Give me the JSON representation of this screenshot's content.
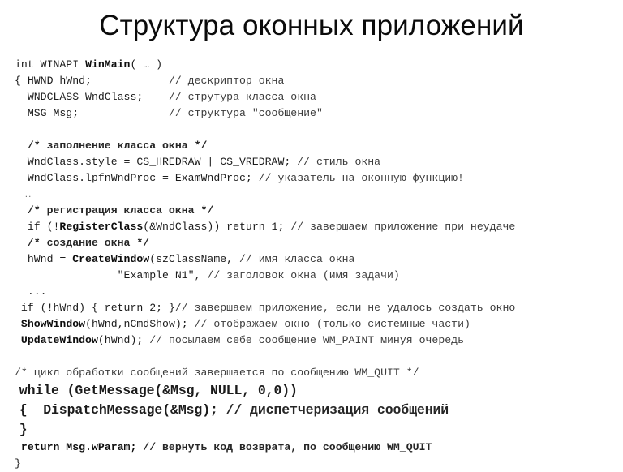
{
  "slide": {
    "title": "Структура оконных приложений",
    "background_color": "#ffffff",
    "text_color": "#1b1b1b",
    "comment_color": "#3c3c3c"
  },
  "code": {
    "language": "c",
    "lines": [
      {
        "id": "l01",
        "indent": 0,
        "size": "normal",
        "segments": [
          {
            "text": "int WINAPI ",
            "style": "plain"
          },
          {
            "text": "WinMain",
            "style": "kw"
          },
          {
            "text": "( … )",
            "style": "plain"
          }
        ]
      },
      {
        "id": "l02",
        "indent": 0,
        "size": "normal",
        "segments": [
          {
            "text": "{ HWND hWnd;            ",
            "style": "plain"
          },
          {
            "text": "// дескриптор окна",
            "style": "cmt"
          }
        ]
      },
      {
        "id": "l03",
        "indent": 0,
        "size": "normal",
        "segments": [
          {
            "text": "  WNDCLASS WndClass;    ",
            "style": "plain"
          },
          {
            "text": "// струтура класса окна",
            "style": "cmt"
          }
        ]
      },
      {
        "id": "l04",
        "indent": 0,
        "size": "normal",
        "segments": [
          {
            "text": "  MSG Msg;              ",
            "style": "plain"
          },
          {
            "text": "// структура \"сообщение\"",
            "style": "cmt"
          }
        ]
      },
      {
        "id": "l05",
        "indent": 0,
        "size": "normal",
        "segments": [
          {
            "text": " ",
            "style": "plain"
          }
        ]
      },
      {
        "id": "l06",
        "indent": 0,
        "size": "normal",
        "segments": [
          {
            "text": "  ",
            "style": "plain"
          },
          {
            "text": "/* заполнение класса окна */",
            "style": "cmt-b"
          }
        ]
      },
      {
        "id": "l07",
        "indent": 0,
        "size": "normal",
        "segments": [
          {
            "text": "  WndClass.style = CS_HREDRAW | CS_VREDRAW; ",
            "style": "plain"
          },
          {
            "text": "// стиль окна",
            "style": "cmt"
          }
        ]
      },
      {
        "id": "l08",
        "indent": 0,
        "size": "normal",
        "segments": [
          {
            "text": "  WndClass.lpfnWndProc = ExamWndProc; ",
            "style": "plain"
          },
          {
            "text": "// указатель на оконную функцию!",
            "style": "cmt"
          }
        ]
      },
      {
        "id": "l09",
        "indent": 0,
        "size": "normal",
        "segments": [
          {
            "text": "  …",
            "style": "dots"
          }
        ]
      },
      {
        "id": "l10",
        "indent": 0,
        "size": "normal",
        "segments": [
          {
            "text": "  ",
            "style": "plain"
          },
          {
            "text": "/* регистрация класса окна */",
            "style": "cmt-b"
          }
        ]
      },
      {
        "id": "l11",
        "indent": 0,
        "size": "normal",
        "segments": [
          {
            "text": "  if (!",
            "style": "plain"
          },
          {
            "text": "RegisterClass",
            "style": "kw"
          },
          {
            "text": "(&WndClass)) return 1; ",
            "style": "plain"
          },
          {
            "text": "// завершаем приложение при неудаче",
            "style": "cmt"
          }
        ]
      },
      {
        "id": "l12",
        "indent": 0,
        "size": "normal",
        "segments": [
          {
            "text": "  ",
            "style": "plain"
          },
          {
            "text": "/* создание окна */",
            "style": "cmt-b"
          }
        ]
      },
      {
        "id": "l13",
        "indent": 0,
        "size": "normal",
        "segments": [
          {
            "text": "  hWnd = ",
            "style": "plain"
          },
          {
            "text": "CreateWindow",
            "style": "kw"
          },
          {
            "text": "(szClassName, ",
            "style": "plain"
          },
          {
            "text": "// имя класса окна",
            "style": "cmt"
          }
        ]
      },
      {
        "id": "l14",
        "indent": 0,
        "size": "normal",
        "segments": [
          {
            "text": "                \"Example N1\", ",
            "style": "plain"
          },
          {
            "text": "// заголовок окна (имя задачи)",
            "style": "cmt"
          }
        ]
      },
      {
        "id": "l15",
        "indent": 0,
        "size": "normal",
        "segments": [
          {
            "text": "  ...",
            "style": "plain"
          }
        ]
      },
      {
        "id": "l16",
        "indent": 0,
        "size": "normal",
        "segments": [
          {
            "text": " if (!hWnd) { return 2; }",
            "style": "plain"
          },
          {
            "text": "// завершаем приложение, если не удалось создать окно",
            "style": "cmt"
          }
        ]
      },
      {
        "id": "l17",
        "indent": 0,
        "size": "normal",
        "segments": [
          {
            "text": " ",
            "style": "plain"
          },
          {
            "text": "ShowWindow",
            "style": "kw"
          },
          {
            "text": "(hWnd,nCmdShow); ",
            "style": "plain"
          },
          {
            "text": "// отображаем окно (только системные части)",
            "style": "cmt"
          }
        ]
      },
      {
        "id": "l18",
        "indent": 0,
        "size": "normal",
        "segments": [
          {
            "text": " ",
            "style": "plain"
          },
          {
            "text": "UpdateWindow",
            "style": "kw"
          },
          {
            "text": "(hWnd); ",
            "style": "plain"
          },
          {
            "text": "// посылаем себе сообщение WM_PAINT минуя очередь",
            "style": "cmt"
          }
        ]
      },
      {
        "id": "l19",
        "indent": 0,
        "size": "normal",
        "segments": [
          {
            "text": " ",
            "style": "plain"
          }
        ]
      },
      {
        "id": "l20",
        "indent": 0,
        "size": "normal",
        "segments": [
          {
            "text": "/* цикл обработки сообщений завершается по сообщению WM_QUIT */",
            "style": "cmt"
          }
        ]
      },
      {
        "id": "l21",
        "indent": 0,
        "size": "big",
        "segments": [
          {
            "text": " while (GetMessage(&Msg, NULL, 0,0))",
            "style": "plain"
          }
        ]
      },
      {
        "id": "l22",
        "indent": 0,
        "size": "big",
        "segments": [
          {
            "text": " {  DispatchMessage(&Msg); ",
            "style": "plain"
          },
          {
            "text": "// диспетчеризация сообщений",
            "style": "cmt-b"
          }
        ]
      },
      {
        "id": "l23",
        "indent": 0,
        "size": "big",
        "segments": [
          {
            "text": " }",
            "style": "plain"
          }
        ]
      },
      {
        "id": "l24",
        "indent": 0,
        "size": "normal",
        "segments": [
          {
            "text": " return Msg.wParam; ",
            "style": "kw"
          },
          {
            "text": "// вернуть код возврата, по сообщению WM_QUIT",
            "style": "cmt-b"
          }
        ]
      },
      {
        "id": "l25",
        "indent": 0,
        "size": "normal",
        "segments": [
          {
            "text": "}",
            "style": "plain"
          }
        ]
      }
    ]
  }
}
